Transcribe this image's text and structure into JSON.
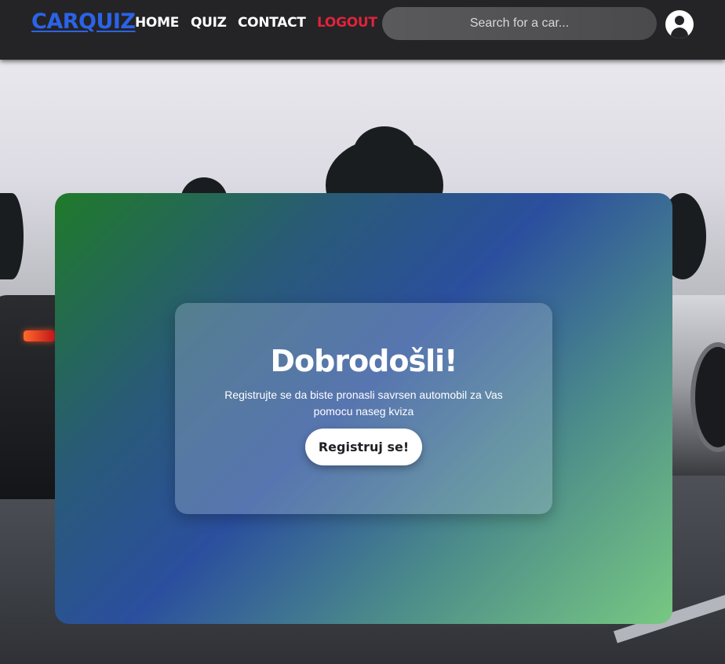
{
  "navbar": {
    "brand": "CARQUIZ",
    "links": {
      "home": "HOME",
      "quiz": "QUIZ",
      "contact": "CONTACT",
      "logout": "LOGOUT"
    },
    "search": {
      "placeholder": "Search for a car...",
      "value": ""
    },
    "user_icon": "user-circle-icon"
  },
  "hero": {
    "title": "Dobrodošli!",
    "subtitle": "Registrujte se da biste pronasli savrsen automobil za Vas pomocu naseg kviza",
    "cta": "Registruj se!"
  },
  "colors": {
    "brand": "#2b63e8",
    "logout": "#e0233a",
    "navbar": "#242426"
  }
}
